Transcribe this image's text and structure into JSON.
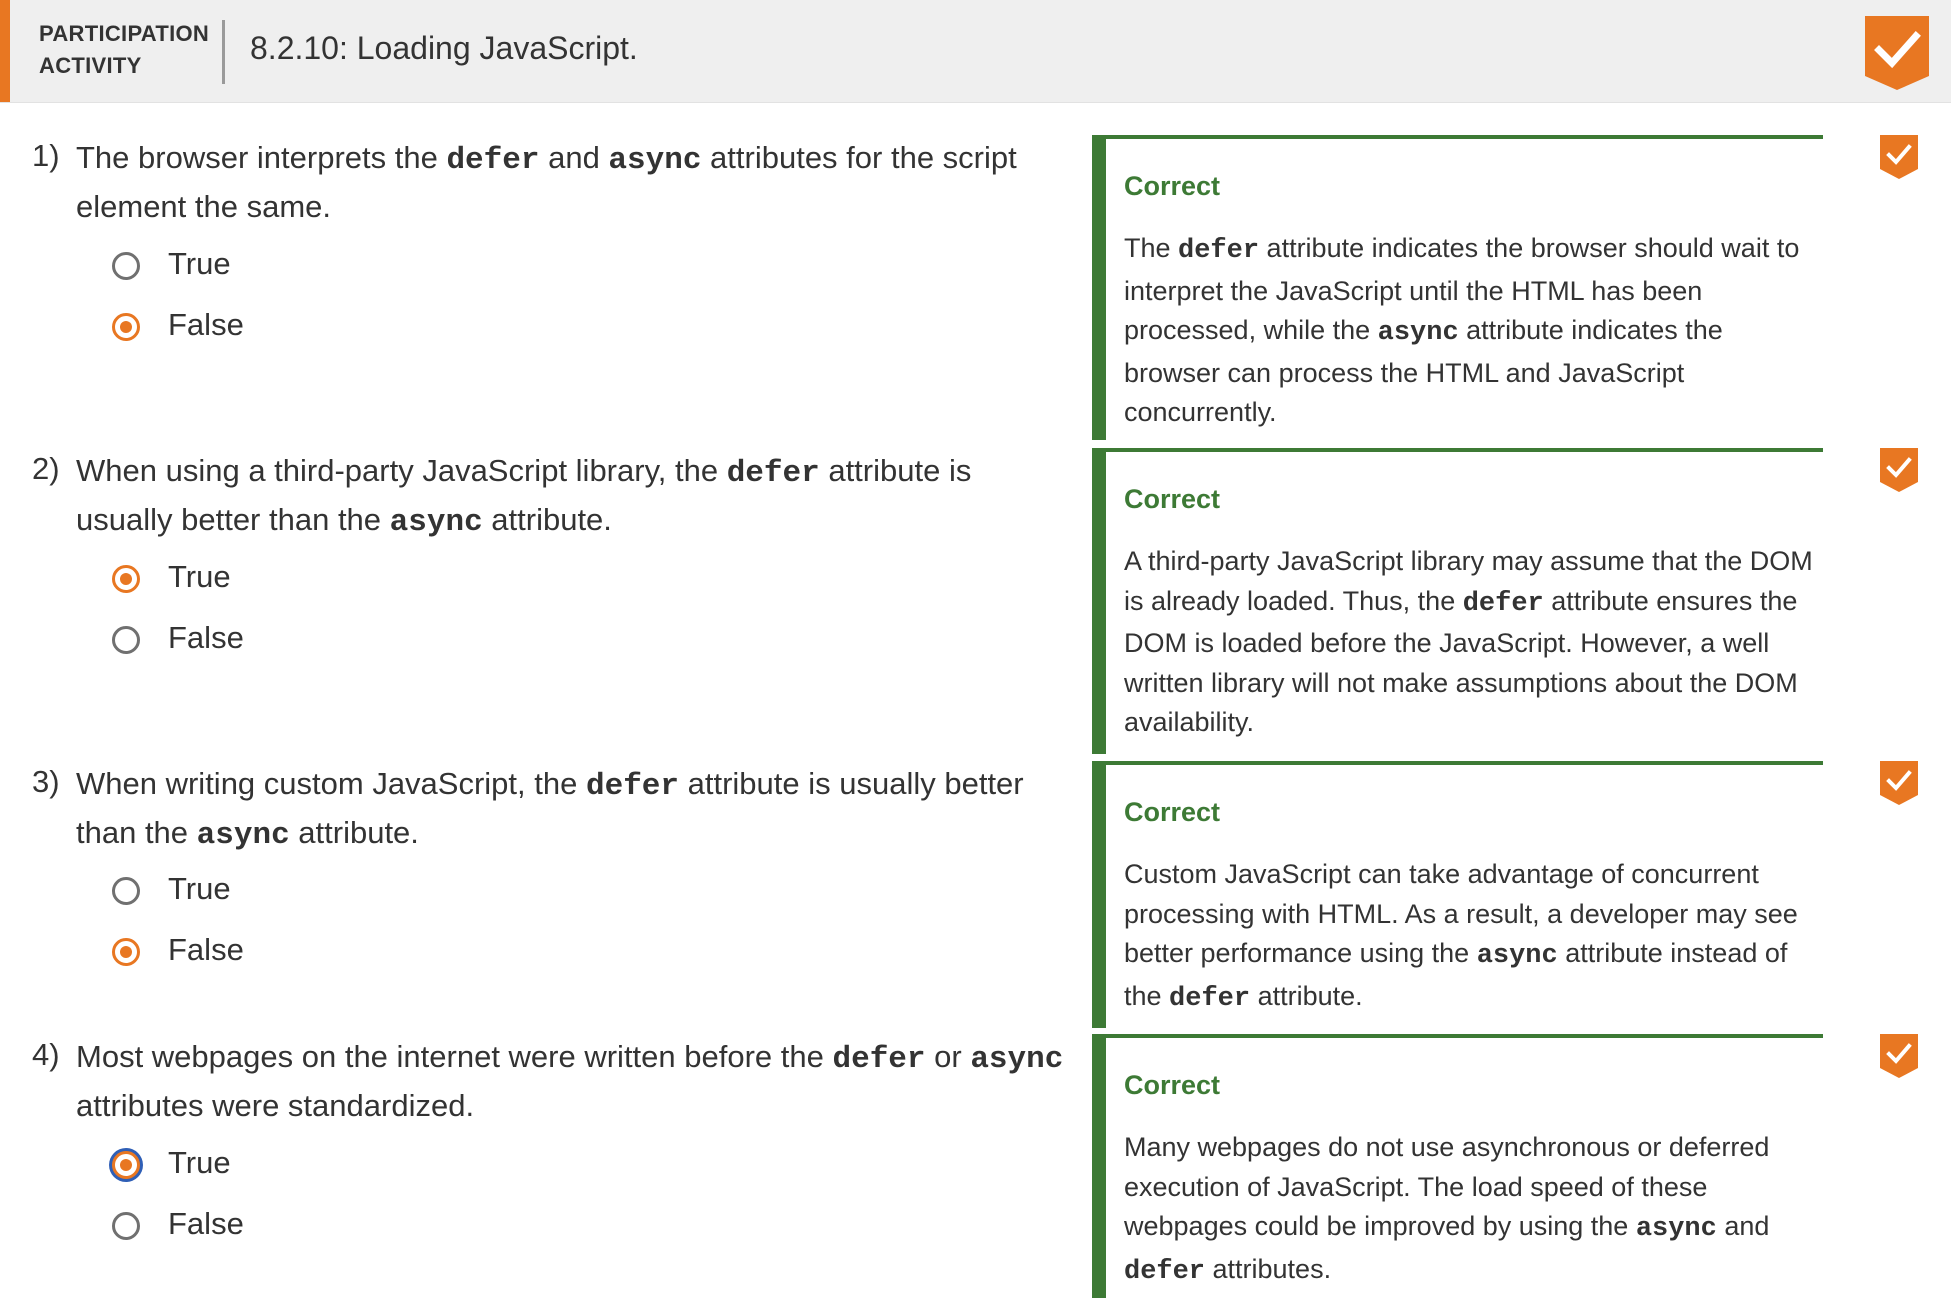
{
  "header": {
    "label_line1": "PARTICIPATION",
    "label_line2": "ACTIVITY",
    "title": "8.2.10: Loading JavaScript.",
    "completed_icon": "check-badge-icon"
  },
  "colors": {
    "accent": "#e87722",
    "correct": "#3d7a35",
    "focus_ring": "#2f5fb6"
  },
  "questions": [
    {
      "number": "1)",
      "text_parts": [
        "The browser interprets the ",
        "defer",
        " and ",
        "async",
        " attributes for the script element the same."
      ],
      "options": [
        "True",
        "False"
      ],
      "selected": "False",
      "feedback_title": "Correct",
      "feedback_parts": [
        "The ",
        "defer",
        " attribute indicates the browser should wait to interpret the JavaScript until the HTML has been processed, while the ",
        "async",
        " attribute indicates the browser can process the HTML and JavaScript concurrently."
      ]
    },
    {
      "number": "2)",
      "text_parts": [
        "When using a third-party JavaScript library, the ",
        "defer",
        " attribute is usually better than the ",
        "async",
        " attribute."
      ],
      "options": [
        "True",
        "False"
      ],
      "selected": "True",
      "feedback_title": "Correct",
      "feedback_parts": [
        "A third-party JavaScript library may assume that the DOM is already loaded. Thus, the ",
        "defer",
        " attribute ensures the DOM is loaded before the JavaScript. However, a well written library will not make assumptions about the DOM availability."
      ]
    },
    {
      "number": "3)",
      "text_parts": [
        "When writing custom JavaScript, the ",
        "defer",
        " attribute is usually better than the ",
        "async",
        " attribute."
      ],
      "options": [
        "True",
        "False"
      ],
      "selected": "False",
      "feedback_title": "Correct",
      "feedback_parts": [
        "Custom JavaScript can take advantage of concurrent processing with HTML. As a result, a developer may see better performance using the ",
        "async",
        " attribute instead of the ",
        "defer",
        " attribute."
      ]
    },
    {
      "number": "4)",
      "text_parts": [
        "Most webpages on the internet were written before the ",
        "defer",
        " or ",
        "async",
        " attributes were standardized."
      ],
      "options": [
        "True",
        "False"
      ],
      "selected": "True",
      "feedback_title": "Correct",
      "feedback_parts": [
        "Many webpages do not use asynchronous or deferred execution of JavaScript. The load speed of these webpages could be improved by using the ",
        "async",
        " and ",
        "defer",
        " attributes."
      ]
    }
  ]
}
